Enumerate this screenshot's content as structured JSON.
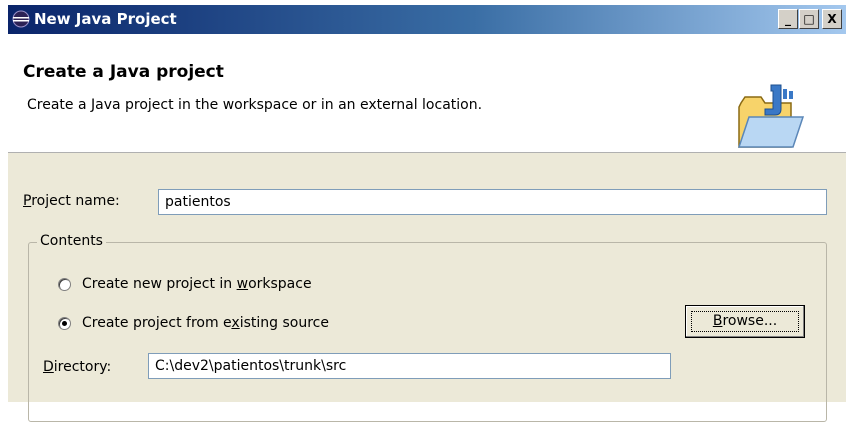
{
  "window": {
    "title": "New Java Project",
    "minimize_glyph": "_",
    "maximize_glyph": "□",
    "close_glyph": "X"
  },
  "banner": {
    "title": "Create a Java project",
    "description": "Create a Java project in the workspace or in an external location.",
    "image_icon": "java-project-folder-icon"
  },
  "form": {
    "project_name_label_prefix": "P",
    "project_name_label_rest": "roject name:",
    "project_name_value": "patientos",
    "contents_group_title": "Contents",
    "radio_new_label_a": "Create new project in ",
    "radio_new_label_u": "w",
    "radio_new_label_b": "orkspace",
    "radio_existing_label_a": "Create project from e",
    "radio_existing_label_u": "x",
    "radio_existing_label_b": "isting source",
    "selected_option": "existing_source",
    "directory_label_prefix": "D",
    "directory_label_rest": "irectory:",
    "directory_value": "C:\\dev2\\patientos\\trunk\\src",
    "browse_label_prefix": "B",
    "browse_label_u": "r",
    "browse_label_rest": "owse..."
  },
  "colors": {
    "titlebar_start": "#0a246a",
    "titlebar_end": "#a6caf0",
    "dialog_background": "#ece9d8"
  }
}
